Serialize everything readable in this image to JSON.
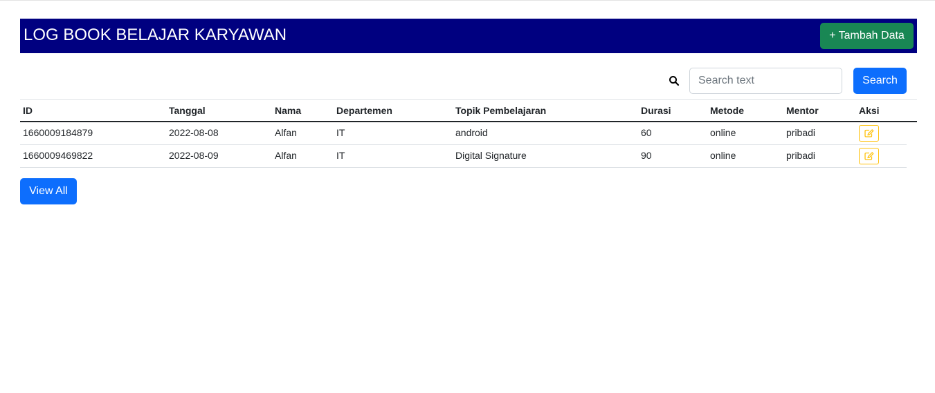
{
  "header": {
    "title": "LOG BOOK BELAJAR KARYAWAN",
    "add_button_label": "+ Tambah Data",
    "background_color": "#000080"
  },
  "search": {
    "icon": "search-icon",
    "placeholder": "Search text",
    "value": "",
    "button_label": "Search"
  },
  "table": {
    "columns": [
      "ID",
      "Tanggal",
      "Nama",
      "Departemen",
      "Topik Pembelajaran",
      "Durasi",
      "Metode",
      "Mentor",
      "Aksi"
    ],
    "rows": [
      [
        "1660009184879",
        "2022-08-08",
        "Alfan",
        "IT",
        "android",
        "60",
        "online",
        "pribadi"
      ],
      [
        "1660009469822",
        "2022-08-09",
        "Alfan",
        "IT",
        "Digital Signature",
        "90",
        "online",
        "pribadi"
      ]
    ],
    "row_action_icon": "edit-icon"
  },
  "footer": {
    "view_all_label": "View All"
  },
  "colors": {
    "primary": "#0d6efd",
    "success": "#198754",
    "warning": "#ffc107"
  }
}
